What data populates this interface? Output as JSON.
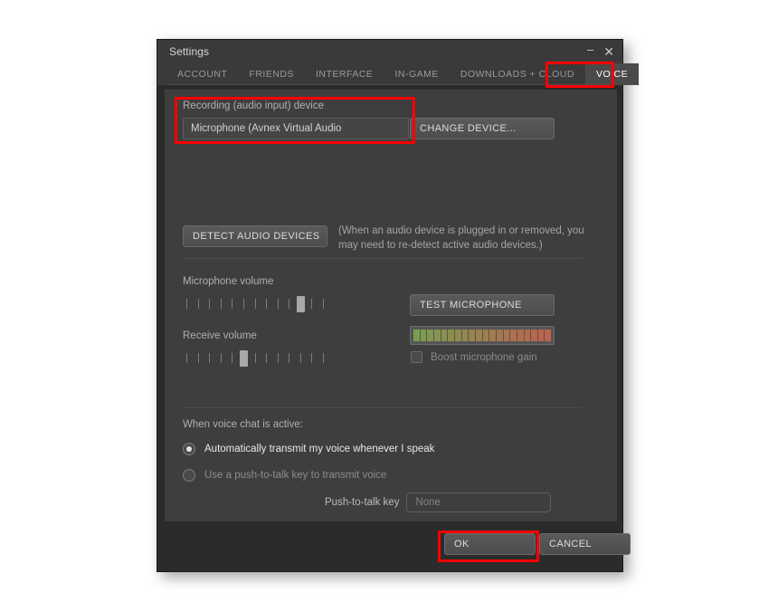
{
  "window": {
    "title": "Settings",
    "controls": {
      "minimize": "–",
      "close": "✕"
    }
  },
  "tabs": [
    {
      "label": "ACCOUNT",
      "active": false
    },
    {
      "label": "FRIENDS",
      "active": false
    },
    {
      "label": "INTERFACE",
      "active": false
    },
    {
      "label": "IN-GAME",
      "active": false
    },
    {
      "label": "DOWNLOADS + CLOUD",
      "active": false
    },
    {
      "label": "VOICE",
      "active": true
    }
  ],
  "recording": {
    "section_label": "Recording (audio input) device",
    "device_value": "Microphone (Avnex Virtual Audio",
    "change_device_label": "CHANGE DEVICE..."
  },
  "detect": {
    "button_label": "DETECT AUDIO DEVICES",
    "help_text": "(When an audio device is plugged in or removed, you may need to re-detect active audio devices.)"
  },
  "volume": {
    "mic_label": "Microphone volume",
    "mic_ticks": 13,
    "mic_value": 11,
    "receive_label": "Receive volume",
    "receive_ticks": 13,
    "receive_value": 6,
    "test_mic_label": "TEST MICROPHONE",
    "meter_segments": 20,
    "boost_label": "Boost microphone gain",
    "boost_checked": false,
    "meter_color_start": "#7a9e4e",
    "meter_color_end": "#c0614e"
  },
  "voice_chat": {
    "section_label": "When voice chat is active:",
    "options": [
      {
        "label": "Automatically transmit my voice whenever I speak",
        "selected": true
      },
      {
        "label": "Use a push-to-talk key to transmit voice",
        "selected": false
      }
    ],
    "ptt_label": "Push-to-talk key",
    "ptt_placeholder": "None"
  },
  "footer": {
    "ok_label": "OK",
    "cancel_label": "CANCEL"
  },
  "annotation_color": "#fe0000"
}
